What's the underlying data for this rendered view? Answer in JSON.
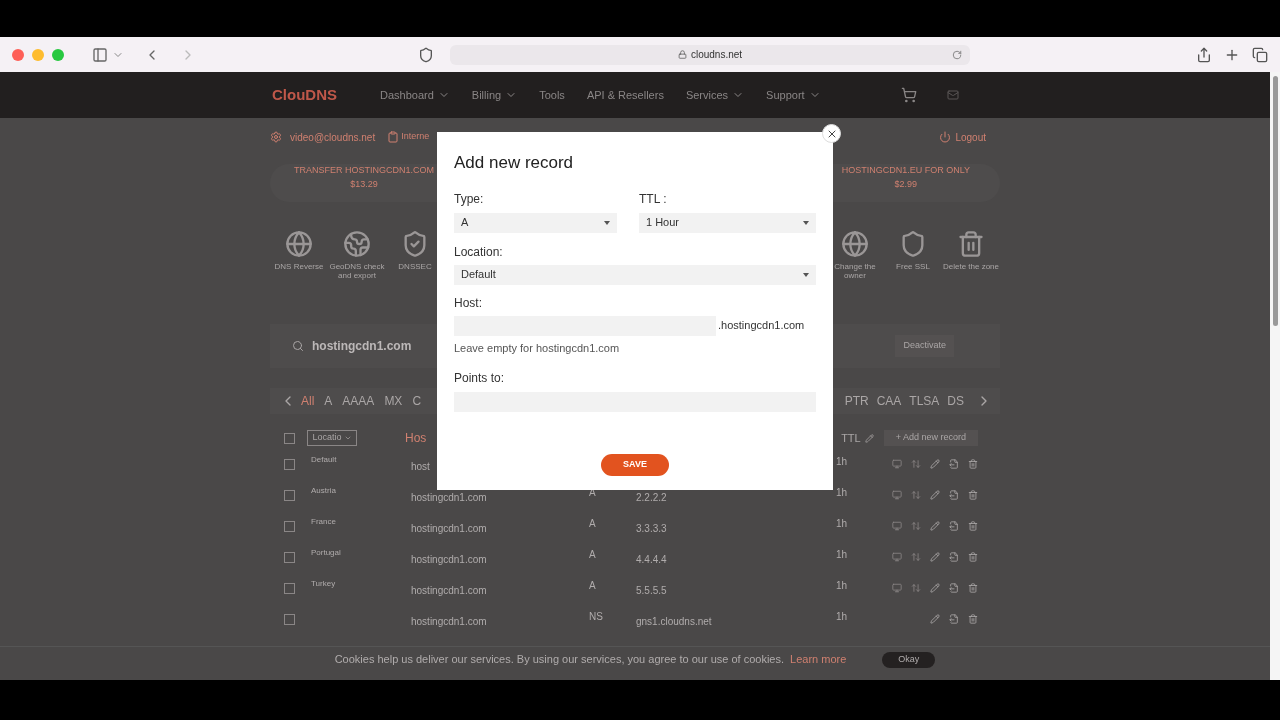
{
  "browser": {
    "url": "cloudns.net"
  },
  "nav": {
    "logo": "ClouDNS",
    "items": [
      {
        "label": "Dashboard",
        "dropdown": true
      },
      {
        "label": "Billing",
        "dropdown": true
      },
      {
        "label": "Tools",
        "dropdown": false
      },
      {
        "label": "API & Resellers",
        "dropdown": false
      },
      {
        "label": "Services",
        "dropdown": true
      },
      {
        "label": "Support",
        "dropdown": true
      }
    ]
  },
  "account": {
    "email": "video@cloudns.net",
    "item": "Interne",
    "logout": "Logout"
  },
  "promo": {
    "left": "TRANSFER HOSTINGCDN1.COM",
    "left_price": "$13.29",
    "right": "HOSTINGCDN1.EU FOR ONLY",
    "right_price": "$2.99"
  },
  "features_left": [
    {
      "kind": "reverse",
      "label": "DNS Reverse"
    },
    {
      "kind": "geo",
      "label": "GeoDNS check and export"
    },
    {
      "kind": "dnssec",
      "label": "DNSSEC"
    }
  ],
  "features_right": [
    {
      "kind": "owner",
      "label": "Change the owner"
    },
    {
      "kind": "ssl",
      "label": "Free SSL"
    },
    {
      "kind": "delete",
      "label": "Delete the zone"
    }
  ],
  "zone": {
    "name": "hostingcdn1.com",
    "action": "Deactivate"
  },
  "record_tabs_left": [
    {
      "label": "All",
      "selected": true
    },
    {
      "label": "A",
      "selected": false
    },
    {
      "label": "AAAA",
      "selected": false
    },
    {
      "label": "MX",
      "selected": false
    },
    {
      "label": "C",
      "selected": false
    }
  ],
  "record_tabs_right": [
    {
      "label": "PTR",
      "selected": false
    },
    {
      "label": "CAA",
      "selected": false
    },
    {
      "label": "TLSA",
      "selected": false
    },
    {
      "label": "DS",
      "selected": false
    }
  ],
  "table": {
    "select_all_checked": false,
    "location_filter": "Locatio",
    "host_header": "Hos",
    "ttl_header": "TTL",
    "add_button": "+ Add new record",
    "rows": [
      {
        "checked": false,
        "location": "Default",
        "host": "host",
        "type": "",
        "points_to": "",
        "ttl": "1h",
        "full_actions": true
      },
      {
        "checked": false,
        "location": "Austria",
        "host": "hostingcdn1.com",
        "type": "A",
        "points_to": "2.2.2.2",
        "ttl": "1h",
        "full_actions": true
      },
      {
        "checked": false,
        "location": "France",
        "host": "hostingcdn1.com",
        "type": "A",
        "points_to": "3.3.3.3",
        "ttl": "1h",
        "full_actions": true
      },
      {
        "checked": false,
        "location": "Portugal",
        "host": "hostingcdn1.com",
        "type": "A",
        "points_to": "4.4.4.4",
        "ttl": "1h",
        "full_actions": true
      },
      {
        "checked": false,
        "location": "Turkey",
        "host": "hostingcdn1.com",
        "type": "A",
        "points_to": "5.5.5.5",
        "ttl": "1h",
        "full_actions": true
      },
      {
        "checked": false,
        "location": "",
        "host": "hostingcdn1.com",
        "type": "NS",
        "points_to": "gns1.cloudns.net",
        "ttl": "1h",
        "full_actions": false
      }
    ]
  },
  "cookie": {
    "text": "Cookies help us deliver our services. By using our services, you agree to our use of cookies.",
    "link": "Learn more",
    "button": "Okay"
  },
  "modal": {
    "title": "Add new record",
    "type_label": "Type:",
    "type_value": "A",
    "ttl_label": "TTL :",
    "ttl_value": "1 Hour",
    "location_label": "Location:",
    "location_value": "Default",
    "host_label": "Host:",
    "host_suffix": ".hostingcdn1.com",
    "host_hint": "Leave empty for hostingcdn1.com",
    "points_label": "Points to:",
    "save": "SAVE"
  }
}
